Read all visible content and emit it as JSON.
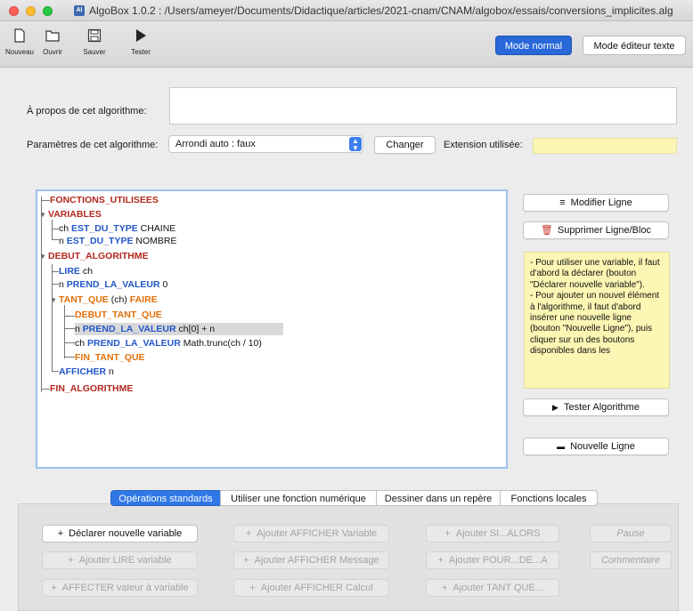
{
  "window": {
    "title": "AlgoBox 1.0.2 : /Users/ameyer/Documents/Didactique/articles/2021-cnam/CNAM/algobox/essais/conversions_implicites.alg",
    "app_icon": "AI"
  },
  "toolbar": {
    "buttons": [
      {
        "label": "Nouveau",
        "icon": "new-document-icon"
      },
      {
        "label": "Ouvrir",
        "icon": "folder-icon"
      },
      {
        "label": "Sauver",
        "icon": "save-icon"
      },
      {
        "label": "Tester",
        "icon": "play-icon"
      }
    ],
    "mode_normal": "Mode normal",
    "mode_editor": "Mode éditeur texte"
  },
  "about": {
    "label": "À propos de cet algorithme:",
    "value": ""
  },
  "params": {
    "label": "Paramètres de cet algorithme:",
    "selected": "Arrondi auto : faux",
    "change_button": "Changer",
    "extension_label": "Extension utilisée:",
    "extension_value": ""
  },
  "tree": {
    "lines": {
      "l0": {
        "kw": "FONCTIONS_UTILISEES"
      },
      "l1": {
        "kw": "VARIABLES"
      },
      "l2": {
        "pre": "ch",
        "kw": "EST_DU_TYPE",
        "post": "CHAINE"
      },
      "l3": {
        "pre": "n",
        "kw": "EST_DU_TYPE",
        "post": "NOMBRE"
      },
      "l4": {
        "kw": "DEBUT_ALGORITHME"
      },
      "l5": {
        "kw": "LIRE",
        "post": "ch"
      },
      "l6": {
        "pre": "n",
        "kw": "PREND_LA_VALEUR",
        "post": "0"
      },
      "l7": {
        "kw": "TANT_QUE",
        "post": "(ch)",
        "kw2": "FAIRE"
      },
      "l8": {
        "kw": "DEBUT_TANT_QUE"
      },
      "l9": {
        "pre": "n",
        "kw": "PREND_LA_VALEUR",
        "post": "ch[0] + n"
      },
      "l10": {
        "pre": "ch",
        "kw": "PREND_LA_VALEUR",
        "post": "Math.trunc(ch / 10)"
      },
      "l11": {
        "kw": "FIN_TANT_QUE"
      },
      "l12": {
        "kw": "AFFICHER",
        "post": "n"
      },
      "l13": {
        "kw": "FIN_ALGORITHME"
      }
    }
  },
  "side": {
    "modify_line": "Modifier Ligne",
    "delete_line": "Supprimer Ligne/Bloc",
    "help_text": "- Pour utiliser une variable, il faut d'abord la déclarer (bouton \"Déclarer nouvelle variable\").\n- Pour ajouter un nouvel élément à l'algorithme, il faut d'abord insérer une nouvelle ligne (bouton \"Nouvelle Ligne\"), puis cliquer sur un des boutons disponibles dans les",
    "test_algo": "Tester Algorithme",
    "new_line": "Nouvelle Ligne"
  },
  "tabs": [
    {
      "label": "Opérations standards",
      "active": true
    },
    {
      "label": "Utiliser une fonction numérique",
      "active": false
    },
    {
      "label": "Dessiner dans un repère",
      "active": false
    },
    {
      "label": "Fonctions locales",
      "active": false
    }
  ],
  "ops": {
    "declare_var": "Déclarer nouvelle variable",
    "add_read": "Ajouter LIRE variable",
    "assign_value": "AFFECTER valeur à variable",
    "add_print_var": "Ajouter AFFICHER Variable",
    "add_print_msg": "Ajouter AFFICHER Message",
    "add_print_calc": "Ajouter AFFICHER Calcul",
    "add_if": "Ajouter SI...ALORS",
    "add_for": "Ajouter POUR...DE...A",
    "add_while": "Ajouter TANT QUE...",
    "pause": "Pause",
    "comment": "Commentaire",
    "plus": "+"
  },
  "colors": {
    "accent": "#2868d8",
    "keyword_red": "#b3281e",
    "keyword_orange": "#e0700a",
    "keyword_blue": "#2357c8",
    "help_bg": "#fbf6b3"
  }
}
